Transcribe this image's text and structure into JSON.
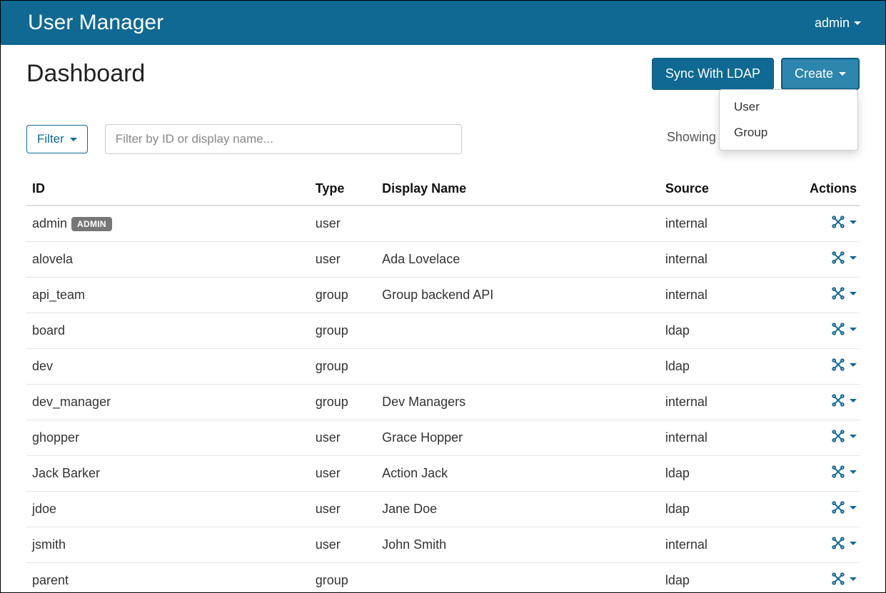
{
  "navbar": {
    "brand": "User Manager",
    "user": "admin"
  },
  "page": {
    "title": "Dashboard"
  },
  "header_buttons": {
    "sync": "Sync With LDAP",
    "create": "Create",
    "dropdown": {
      "user": "User",
      "group": "Group"
    }
  },
  "filter": {
    "button": "Filter",
    "placeholder": "Filter by ID or display name...",
    "value": ""
  },
  "status": "Showing 1-19 of 19",
  "columns": {
    "id": "ID",
    "type": "Type",
    "display_name": "Display Name",
    "source": "Source",
    "actions": "Actions"
  },
  "rows": [
    {
      "id": "admin",
      "badge": "ADMIN",
      "type": "user",
      "display_name": "",
      "source": "internal"
    },
    {
      "id": "alovela",
      "badge": "",
      "type": "user",
      "display_name": "Ada Lovelace",
      "source": "internal"
    },
    {
      "id": "api_team",
      "badge": "",
      "type": "group",
      "display_name": "Group backend API",
      "source": "internal"
    },
    {
      "id": "board",
      "badge": "",
      "type": "group",
      "display_name": "",
      "source": "ldap"
    },
    {
      "id": "dev",
      "badge": "",
      "type": "group",
      "display_name": "",
      "source": "ldap"
    },
    {
      "id": "dev_manager",
      "badge": "",
      "type": "group",
      "display_name": "Dev Managers",
      "source": "internal"
    },
    {
      "id": "ghopper",
      "badge": "",
      "type": "user",
      "display_name": "Grace Hopper",
      "source": "internal"
    },
    {
      "id": "Jack Barker",
      "badge": "",
      "type": "user",
      "display_name": "Action Jack",
      "source": "ldap"
    },
    {
      "id": "jdoe",
      "badge": "",
      "type": "user",
      "display_name": "Jane Doe",
      "source": "ldap"
    },
    {
      "id": "jsmith",
      "badge": "",
      "type": "user",
      "display_name": "John Smith",
      "source": "internal"
    },
    {
      "id": "parent",
      "badge": "",
      "type": "group",
      "display_name": "",
      "source": "ldap"
    }
  ]
}
